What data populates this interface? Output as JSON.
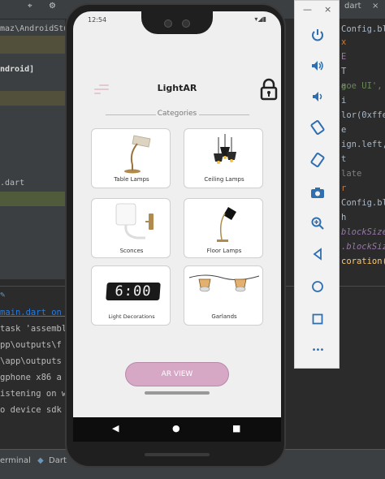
{
  "ide": {
    "left_panel": [
      "maz\\AndroidStu",
      "ndroid]",
      ".dart"
    ],
    "right_code": [
      "Config.bl",
      "x",
      "E",
      "T",
      "a",
      "goe UI',",
      "i",
      "lor(0xffe",
      "e",
      "ign.left,",
      "t",
      "late",
      "r",
      "Config.bl",
      "h",
      "blockSize",
      ".blockSiz",
      "coration("
    ],
    "terminal_lines": [
      "main.dart on s",
      "task 'assembl",
      "pp\\outputs\\f",
      "\\app\\outputs",
      "gphone x86 a",
      "istening on w",
      "o device sdk"
    ],
    "top_tab": "dart",
    "status_tabs": [
      "erminal",
      "Dart"
    ]
  },
  "phone": {
    "status_time": "12:54",
    "status_icons": "▾◢▮"
  },
  "app": {
    "title": "LightAR",
    "categories_label": "Categories",
    "cards": [
      {
        "label": "Table Lamps"
      },
      {
        "label": "Ceiling Lamps"
      },
      {
        "label": "Sconces"
      },
      {
        "label": "Floor Lamps"
      },
      {
        "label": "Light Decorations",
        "clock_text": "6:00"
      },
      {
        "label": "Garlands"
      }
    ],
    "ar_button": "AR VIEW"
  },
  "navbar": {
    "back": "◀",
    "home": "●",
    "recents": "■"
  },
  "emulator": {
    "minimize": "—",
    "close": "×",
    "more": "•••",
    "icons": [
      "power-icon",
      "volume-up-icon",
      "volume-down-icon",
      "rotate-left-icon",
      "rotate-right-icon",
      "camera-icon",
      "zoom-icon",
      "back-icon",
      "home-icon",
      "overview-icon",
      "more-icon"
    ]
  },
  "colors": {
    "ar_button": "#d7a7c6",
    "menu_icon": "#e2c8d2",
    "emulator_icon": "#2f6fb0"
  }
}
